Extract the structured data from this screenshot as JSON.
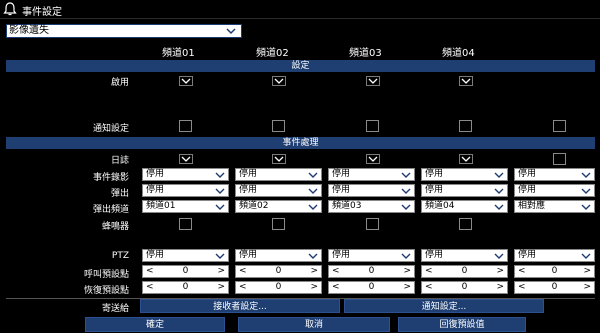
{
  "window": {
    "title": "事件設定"
  },
  "event_type": {
    "value": "影像遺失"
  },
  "channels": [
    "頻道01",
    "頻道02",
    "頻道03",
    "頻道04"
  ],
  "sections": {
    "settings": "設定",
    "handling": "事件處理"
  },
  "labels": {
    "enable": "啟用",
    "notify": "通知設定",
    "log": "日誌",
    "record": "事件錄影",
    "popup": "彈出",
    "popup_channel": "彈出頻道",
    "buzzer": "蜂鳴器",
    "ptz": "PTZ",
    "call_preset": "呼叫預設點",
    "restore_preset": "恢復預設點",
    "send_to": "寄送給"
  },
  "record_values": [
    "停用",
    "停用",
    "停用",
    "停用",
    "停用"
  ],
  "popup_values": [
    "停用",
    "停用",
    "停用",
    "停用",
    "停用"
  ],
  "popup_channel_values": [
    "頻道01",
    "頻道02",
    "頻道03",
    "頻道04",
    "相對應"
  ],
  "ptz_values": [
    "停用",
    "停用",
    "停用",
    "停用",
    "停用"
  ],
  "call_preset_values": [
    "0",
    "0",
    "0",
    "0",
    "0"
  ],
  "restore_preset_values": [
    "0",
    "0",
    "0",
    "0",
    "0"
  ],
  "spin": {
    "left": "<",
    "right": ">"
  },
  "buttons": {
    "receiver_settings": "接收者設定...",
    "notify_settings": "通知設定...",
    "ok": "確定",
    "cancel": "取消",
    "restore_default": "回復預設值"
  },
  "colors": {
    "accent": "#1f3f73",
    "background": "#000000",
    "text": "#ffffff"
  }
}
